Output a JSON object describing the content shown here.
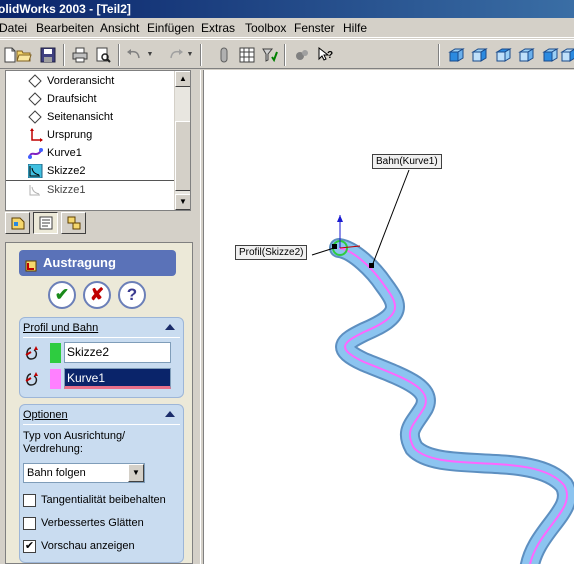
{
  "window": {
    "title": "olidWorks 2003 - [Teil2]"
  },
  "menubar": {
    "items": [
      {
        "label": "Datei",
        "hotkey": "D"
      },
      {
        "label": "Bearbeiten",
        "hotkey": "B"
      },
      {
        "label": "Ansicht",
        "hotkey": "A"
      },
      {
        "label": "Einfügen",
        "hotkey": "E"
      },
      {
        "label": "Extras",
        "hotkey": "x"
      },
      {
        "label": "Toolbox",
        "hotkey": "T"
      },
      {
        "label": "Fenster",
        "hotkey": "F"
      },
      {
        "label": "Hilfe",
        "hotkey": "H"
      }
    ]
  },
  "toolbar": {
    "buttons": [
      "new-file-icon",
      "open-folder-icon",
      "save-icon",
      "print-icon",
      "print-preview-icon",
      "undo-icon",
      "redo-icon",
      "pointer-icon",
      "grid-icon",
      "filter-icon",
      "rebuild-icon",
      "whats-this-icon",
      "view-cube-icons"
    ]
  },
  "feature_tree": {
    "items": [
      {
        "label": "Vorderansicht",
        "icon": "plane-icon"
      },
      {
        "label": "Draufsicht",
        "icon": "plane-icon"
      },
      {
        "label": "Seitenansicht",
        "icon": "plane-icon"
      },
      {
        "label": "Ursprung",
        "icon": "origin-icon"
      },
      {
        "label": "Kurve1",
        "icon": "curve-icon"
      },
      {
        "label": "Skizze2",
        "icon": "sketch-icon"
      },
      {
        "label": "Skizze1",
        "icon": "sketch-icon-dimmed"
      }
    ]
  },
  "property_manager": {
    "title": "Austragung",
    "buttons": {
      "ok": "✔",
      "cancel": "✘",
      "help": "?"
    },
    "profile_group": {
      "title": "Profil und Bahn",
      "profile_value": "Skizze2",
      "path_value": "Kurve1",
      "profile_color": "#2ecc40",
      "path_color": "#ff80ff"
    },
    "options_group": {
      "title": "Optionen",
      "orientation_label_1": "Typ von Ausrichtung/",
      "orientation_label_2": "Verdrehung:",
      "orientation_value": "Bahn folgen",
      "checkboxes": [
        {
          "label": "Tangentialität beibehalten",
          "checked": false
        },
        {
          "label": "Verbessertes Glätten",
          "checked": false
        },
        {
          "label": "Vorschau anzeigen",
          "checked": true
        }
      ]
    }
  },
  "viewport": {
    "callout_profile": "Profil(Skizze2)",
    "callout_path": "Bahn(Kurve1)",
    "sweep_color": "#7fb7e8",
    "path_line_color": "#ff66ff"
  }
}
